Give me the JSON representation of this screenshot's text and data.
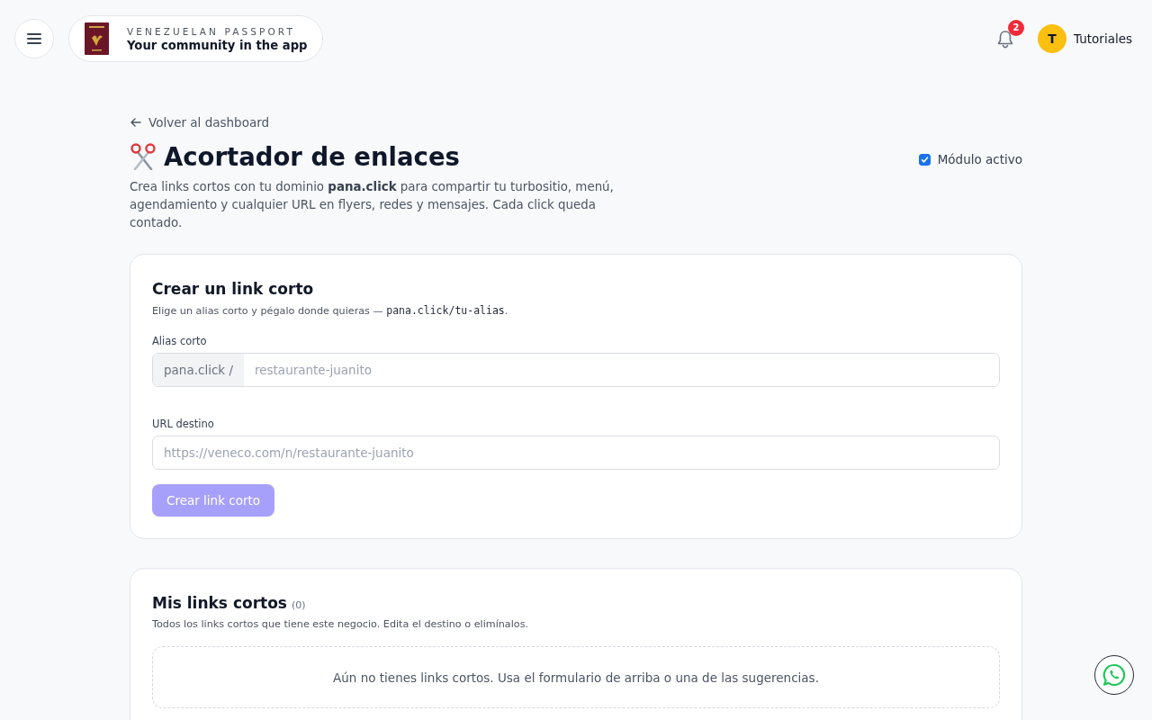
{
  "header": {
    "brand": {
      "overline": "VENEZUELAN PASSPORT",
      "title": "Your community in the app"
    },
    "notifications": {
      "count": "2"
    },
    "user": {
      "initial": "T",
      "name": "Tutoriales"
    }
  },
  "page": {
    "back_link": "Volver al dashboard",
    "title": "Acortador de enlaces",
    "description": "Crea links cortos con tu dominio **pana.click** para compartir tu turbositio, menú, agendamiento y cualquier URL en flyers, redes y mensajes. Cada click queda contado.",
    "module_toggle": {
      "label": "Módulo activo",
      "checked": true
    }
  },
  "create_card": {
    "title": "Crear un link corto",
    "subtitle": [
      {
        "kind": "text",
        "text": "Elige un alias corto y pégalo donde quieras — "
      },
      {
        "kind": "code",
        "text": "pana.click/tu-alias"
      },
      {
        "kind": "text",
        "text": "."
      }
    ],
    "fields": [
      {
        "label": "Alias corto",
        "prefix": "pana.click /",
        "placeholder": "restaurante-juanito"
      },
      {
        "label": "URL destino",
        "placeholder": "https://veneco.com/n/restaurante-juanito"
      }
    ],
    "submit": {
      "label": "Crear link corto",
      "disabled": true
    }
  },
  "links_card": {
    "title": "Mis links cortos",
    "count": "(0)",
    "subtitle": "Todos los links cortos que tiene este negocio. Edita el destino o elimínalos.",
    "empty_message": "Aún no tienes links cortos. Usa el formulario de arriba o una de las sugerencias."
  }
}
